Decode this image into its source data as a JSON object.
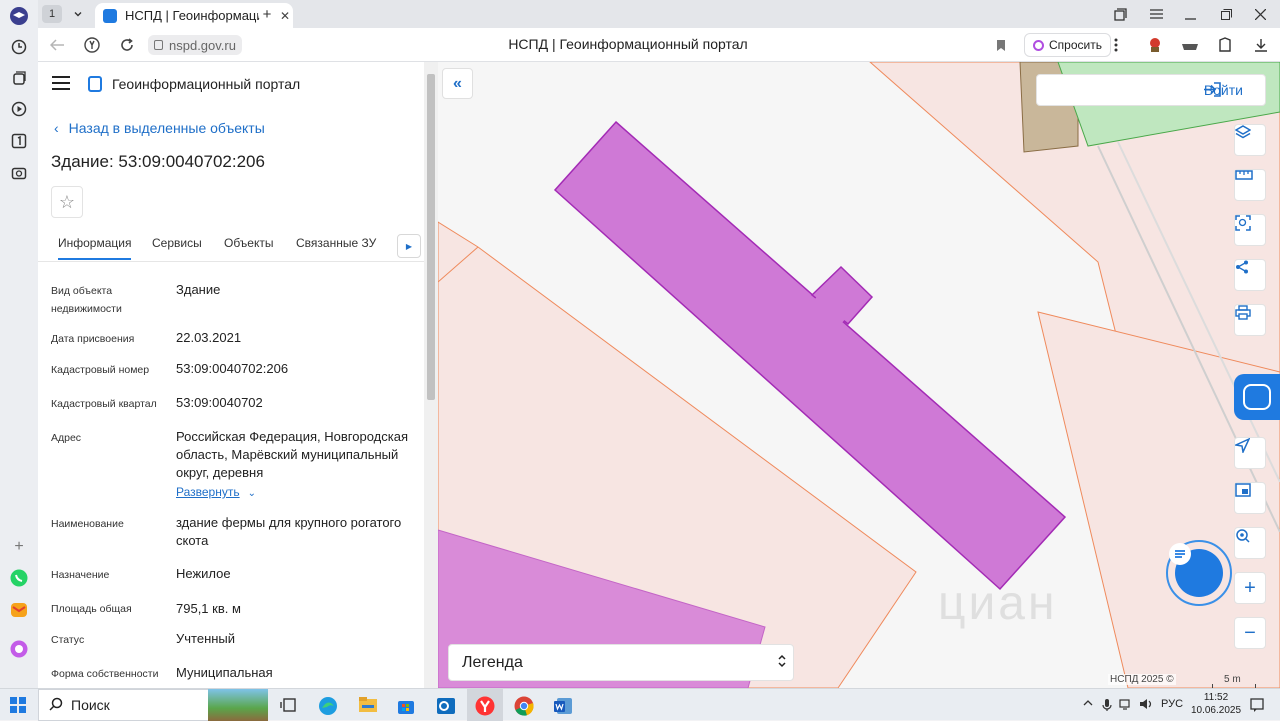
{
  "browser": {
    "tab_count": "1",
    "tab_title": "НСПД | Геоинформацио",
    "tab_close": "✕",
    "new_tab": "+",
    "url": "nspd.gov.ru",
    "page_title": "НСПД | Геоинформационный портал",
    "ask_label": "Спросить"
  },
  "panel": {
    "portal_name": "Геоинформационный портал",
    "back_label": "Назад в выделенные объекты",
    "object_title": "Здание: 53:09:0040702:206",
    "tabs": [
      "Информация",
      "Сервисы",
      "Объекты",
      "Связанные ЗУ"
    ],
    "properties": [
      {
        "label": "Вид объекта недвижимости",
        "value": "Здание"
      },
      {
        "label": "Дата присвоения",
        "value": "22.03.2021"
      },
      {
        "label": "Кадастровый номер",
        "value": "53:09:0040702:206"
      },
      {
        "label": "Кадастровый квартал",
        "value": "53:09:0040702"
      },
      {
        "label": "Адрес",
        "value": "Российская Федерация, Новгородская область, Марёвский муниципальный округ, деревня"
      },
      {
        "label": "Наименование",
        "value": "здание фермы для крупного рогатого скота"
      },
      {
        "label": "Назначение",
        "value": "Нежилое"
      },
      {
        "label": "Площадь общая",
        "value": "795,1 кв. м"
      },
      {
        "label": "Статус",
        "value": "Учтенный"
      },
      {
        "label": "Форма собственности",
        "value": "Муниципальная"
      }
    ],
    "expand_label": "Развернуть"
  },
  "map": {
    "login_label": "Войти",
    "legend_label": "Легенда",
    "copyright": "НСПД 2025 ©",
    "scale_label": "5 m",
    "watermark": "циан",
    "colors": {
      "building_fill": "#cf79d6",
      "building_stroke": "#a32bb5",
      "parcel_fill": "#f7e5e2",
      "parcel_stroke": "#ef8a5c",
      "green_area": "#bfe7bf",
      "brown_area": "#c9b79a"
    }
  },
  "taskbar": {
    "search_label": "Поиск",
    "lang": "РУС",
    "time": "11:52",
    "date": "10.06.2025"
  }
}
